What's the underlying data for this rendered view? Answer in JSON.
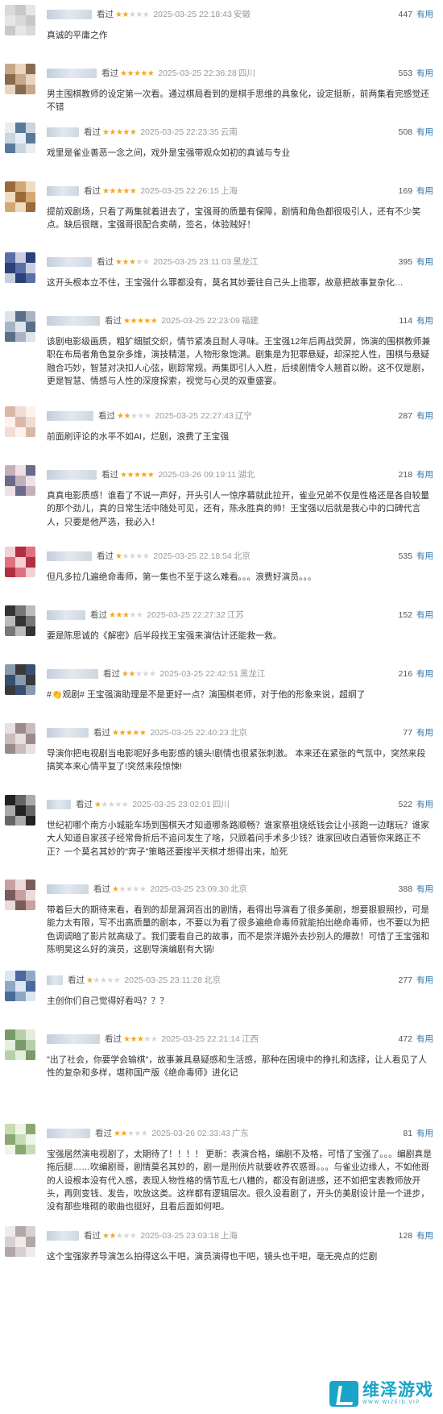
{
  "seen_label": "看过",
  "useful_label": "有用",
  "colors": {
    "star": "#f5a623",
    "star_off": "#d5d5d5",
    "useful": "#3377aa",
    "brand": "#1aa4c8"
  },
  "watermark": {
    "logo_text": "维泽游戏",
    "logo_sub": "WWW.WIZEID.VIP",
    "icon": "wize-logo-icon"
  },
  "reviews": [
    {
      "stars": 2,
      "time": "2025-03-25 22:18:43",
      "location": "安徽",
      "votes": "447",
      "text": "真诚的平庸之作"
    },
    {
      "stars": 5,
      "time": "2025-03-25 22:36:28",
      "location": "四川",
      "votes": "553",
      "text": "男主围棋教师的设定第一次看。通过棋局看到的是棋手思维的具象化，设定挺新，前两集看完感觉还不错"
    },
    {
      "stars": 5,
      "time": "2025-03-25 22:23:35",
      "location": "云南",
      "votes": "508",
      "text": "戏里是雀业善恶一念之间，戏外是宝强带观众如初的真诚与专业"
    },
    {
      "stars": 5,
      "time": "2025-03-25 22:26:15",
      "location": "上海",
      "votes": "169",
      "text": "提前观剧场，只看了两集就着进去了，宝强哥的质量有保障，剧情和角色都很吸引人，还有不少笑点。缺后很瞎，宝强哥很配合卖萌，签名，体验贼好！"
    },
    {
      "stars": 3,
      "time": "2025-03-25 23:11:03",
      "location": "黑龙江",
      "votes": "395",
      "text": "这开头根本立不住，王宝强什么罪都没有，莫名其妙要往自己头上揽罪，故意把故事复杂化…"
    },
    {
      "stars": 5,
      "time": "2025-03-25 22:23:09",
      "location": "福建",
      "votes": "114",
      "text": "该剧电影级画质，粗犷细腻交织，情节紧凑且耐人寻味。王宝强12年后再战荧屏，饰演的围棋教师兼职在布局者角色复杂多维，演技精湛，人物形象饱满。剧集是为犯罪悬疑，却深挖人性，围棋与悬疑融合巧妙，智慧对决扣人心弦，剧踪常规。两集即引人入胜，后续剧情令人翘首以盼。这不仅是剧，更是智慧、情感与人性的深度探索，视觉与心灵的双重盛宴。"
    },
    {
      "stars": 2,
      "time": "2025-03-25 22:27:43",
      "location": "辽宁",
      "votes": "287",
      "text": "前面刷评论的水平不如AI，烂剧，浪费了王宝强"
    },
    {
      "stars": 5,
      "time": "2025-03-26 09:19:11",
      "location": "湖北",
      "votes": "218",
      "text": "真真电影质感！谁看了不说一声好，开头引人一惊序幕就此拉开，雀业兄弟不仅是性格还是各自较量的那个劲儿，真的日常生活中随处可见，还有，陈永胜真的帅！王宝强以后就是我心中的口碑代言人，只要是他严选，我必入！"
    },
    {
      "stars": 1,
      "time": "2025-03-25 22:18:54",
      "location": "北京",
      "votes": "535",
      "text": "但凡多拉几遍绝命毒师，第一集也不至于这么难看。。。浪费好演员。。。"
    },
    {
      "stars": 3,
      "time": "2025-03-25 22:27:32",
      "location": "江苏",
      "votes": "152",
      "text": "要是陈思诚的《解密》后半段找王宝强来演估计还能救一救。"
    },
    {
      "stars": 2,
      "time": "2025-03-25 22:42:51",
      "location": "黑龙江",
      "votes": "216",
      "text": "#👏观剧# 王宝强演助理是不是更好一点？演围棋老师，对于他的形象来说，超纲了"
    },
    {
      "stars": 5,
      "time": "2025-03-25 22:40:23",
      "location": "北京",
      "votes": "77",
      "text": "导演你把电视剧当电影呢好多电影感的镜头!剧情也很紧张刺激。 本来还在紧张的气氛中，突然来段搞笑本来心情平复了!突然来段惊悚!"
    },
    {
      "stars": 1,
      "time": "2025-03-25 23:02:01",
      "location": "四川",
      "votes": "522",
      "text": "世纪初哪个南方小城能车场到围棋天才知道哪条路顺畅？谁家祭祖烧纸钱会让小孩跑一边瞎玩？谁家大人知道自家孩子经常骨折后不追问发生了啥，只顾着问手术多少钱？谁家回收白酒管你来路正不正？一个莫名其妙的\"奔子\"策略还要搜半天棋才想得出来，尬死"
    },
    {
      "stars": 1,
      "time": "2025-03-25 23:09:30",
      "location": "北京",
      "votes": "388",
      "text": "带着巨大的期待来看，看到的却是漏洞百出的剧情，看得出导演看了很多美剧，想要狠狠照抄，可是能力太有限，写不出高质量的剧本，不要以为看了很多遍绝命毒师就能拍出绝命毒师，也不要以为把色调调暗了影片就高级了。我们要看自己的故事，而不是崇洋媚外去抄别人的爆款！可惜了王宝强和陈明昊这么好的演员，这剧导演编剧有大锅!"
    },
    {
      "stars": 1,
      "time": "2025-03-25 23:11:28",
      "location": "北京",
      "votes": "277",
      "text": "主创你们自己觉得好看吗？？？"
    },
    {
      "stars": 3,
      "time": "2025-03-25 22:21:14",
      "location": "江西",
      "votes": "472",
      "text": "\"出了社会，你要学会输棋\"，故事兼具悬疑感和生活感，那种在困境中的挣扎和选择，让人看见了人性的复杂和多样，堪称国产版《绝命毒师》进化记"
    },
    {
      "stars": 2,
      "time": "2025-03-26 02:33:43",
      "location": "广东",
      "votes": "81",
      "text": "宝强居然演电视剧了，太期待了！！！！ 更新：表演合格，编剧不及格，可惜了宝强了。。。编剧真是拖后腿……吹编剧哥，剧情莫名其妙的，剧一是刑侦片就要收养农惑哥。。。与雀业边缘人，不如他哥的人设根本没有代入感，表现人物性格的情节乱七八糟的，都没有剧进感，还不如把宝表教师放开头，再则变钱、发告，吹放这类。这样都有逻辑层次。很久没看剧了，开头仿美剧设计是一个进步，没有那些堆砌的歌曲也挺好，且看后面如何吧。"
    },
    {
      "stars": 2,
      "time": "2025-03-25 23:03:18",
      "location": "上海",
      "votes": "128",
      "text": "这个宝强家养导演怎么拍得这么干吧，演员演得也干吧，镜头也干吧，毫无亮点的烂剧"
    }
  ]
}
